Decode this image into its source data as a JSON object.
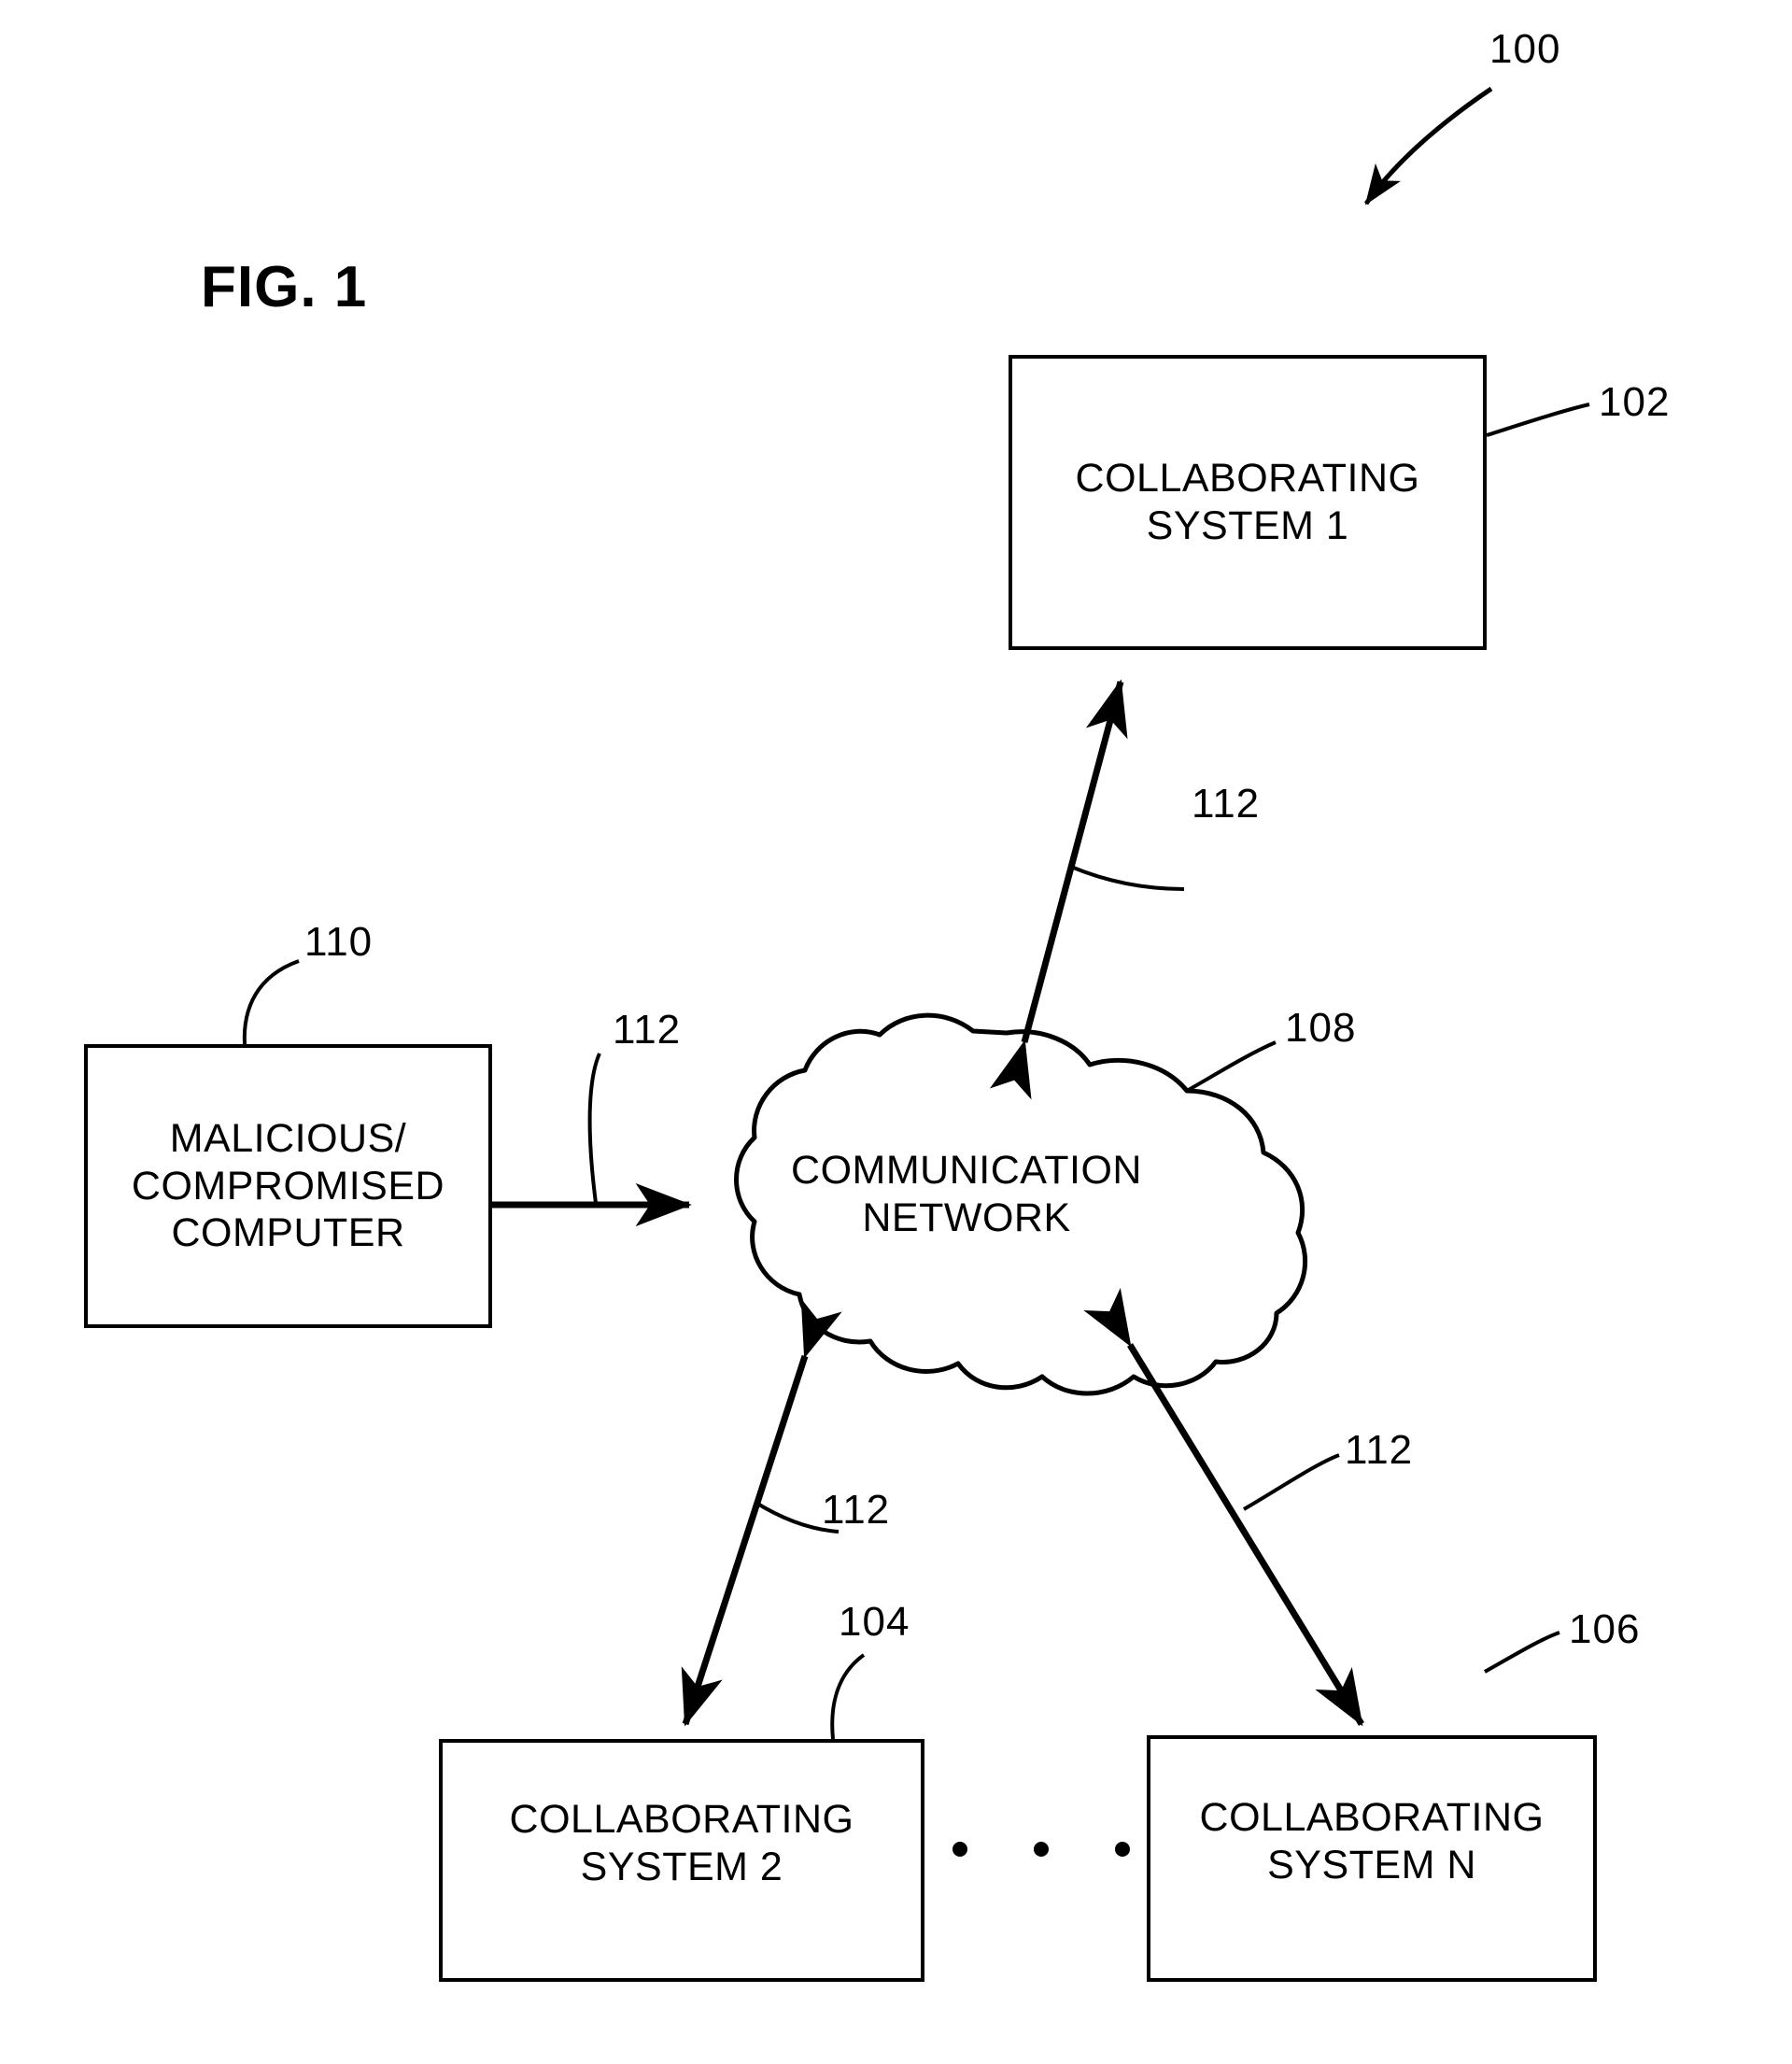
{
  "figure": {
    "title": "FIG. 1",
    "overall_ref": "100"
  },
  "nodes": [
    {
      "id": "collaborating-system-1",
      "label": "COLLABORATING\nSYSTEM 1",
      "ref": "102"
    },
    {
      "id": "collaborating-system-2",
      "label": "COLLABORATING\nSYSTEM 2",
      "ref": "104"
    },
    {
      "id": "collaborating-system-n",
      "label": "COLLABORATING\nSYSTEM N",
      "ref": "106"
    },
    {
      "id": "communication-network",
      "label": "COMMUNICATION\nNETWORK",
      "ref": "108"
    },
    {
      "id": "malicious-compromised-computer",
      "label": "MALICIOUS/\nCOMPROMISED\nCOMPUTER",
      "ref": "110"
    }
  ],
  "links": [
    {
      "id": "link-network-system1",
      "ref": "112",
      "from": "communication-network",
      "to": "collaborating-system-1",
      "arrow": "double"
    },
    {
      "id": "link-malicious-network",
      "ref": "112",
      "from": "malicious-compromised-computer",
      "to": "communication-network",
      "arrow": "double"
    },
    {
      "id": "link-network-system2",
      "ref": "112",
      "from": "communication-network",
      "to": "collaborating-system-2",
      "arrow": "double"
    },
    {
      "id": "link-network-systemn",
      "ref": "112",
      "from": "communication-network",
      "to": "collaborating-system-n",
      "arrow": "double"
    }
  ],
  "ellipsis": {
    "id": "ellipsis-between-systems",
    "dot_count": 3
  },
  "colors": {
    "stroke": "#000000",
    "background": "#ffffff"
  }
}
